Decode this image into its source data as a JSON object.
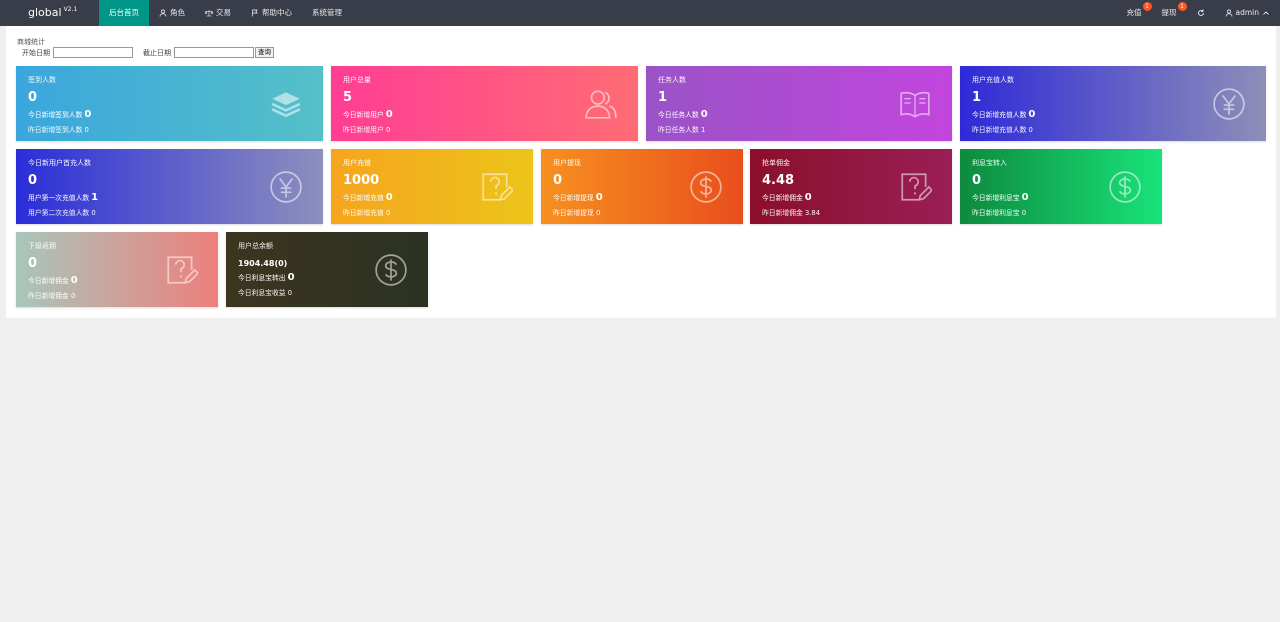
{
  "app": {
    "name": "global",
    "version": "V2.1"
  },
  "nav": [
    {
      "label": "后台首页",
      "icon": "home-icon",
      "active": true
    },
    {
      "label": "角色",
      "icon": "user-icon",
      "active": false
    },
    {
      "label": "交易",
      "icon": "scale-icon",
      "active": false
    },
    {
      "label": "帮助中心",
      "icon": "flag-icon",
      "active": false
    },
    {
      "label": "系统管理",
      "icon": "",
      "active": false
    }
  ],
  "right_nav": {
    "recharge": {
      "label": "充值",
      "badge": "1"
    },
    "withdraw": {
      "label": "提现",
      "badge": "1"
    },
    "refresh_icon": "refresh-icon",
    "user": {
      "label": "admin",
      "icon": "user-icon"
    }
  },
  "section": {
    "title": "商城统计",
    "start_label": "开始日期",
    "end_label": "截止日期",
    "start_value": "",
    "end_value": "",
    "query_label": "查询"
  },
  "cards": [
    {
      "title": "签到人数",
      "value": "0",
      "sub_label": "今日新增签到人数",
      "sub_value": "0",
      "sub2": "昨日新增签到人数 0",
      "icon": "layers-icon",
      "color": "#3aa6dd"
    },
    {
      "title": "用户总量",
      "value": "5",
      "sub_label": "今日新增用户",
      "sub_value": "0",
      "sub2": "昨日新增用户 0",
      "icon": "users-icon",
      "color": "#ff3d94"
    },
    {
      "title": "任务人数",
      "value": "1",
      "sub_label": "今日任务人数",
      "sub_value": "0",
      "sub2": "昨日任务人数 1",
      "icon": "book-icon",
      "color": "#9a53c7"
    },
    {
      "title": "用户充值人数",
      "value": "1",
      "sub_label": "今日新增充值人数",
      "sub_value": "0",
      "sub2": "昨日新增充值人数 0",
      "icon": "yen-icon",
      "color": "#2e2ad8"
    },
    {
      "title": "今日新用户首充人数",
      "value": "0",
      "sub_label": "用户第一次充值人数",
      "sub_value": "1",
      "sub2": "用户第二次充值人数 0",
      "icon": "yen-icon",
      "color": "#2a2ed8"
    },
    {
      "title": "用户充值",
      "value": "1000",
      "sub_label": "今日新增充值",
      "sub_value": "0",
      "sub2": "昨日新增充值 0",
      "icon": "question-edit-icon",
      "color": "#f6a51e"
    },
    {
      "title": "用户提现",
      "value": "0",
      "sub_label": "今日新增提现",
      "sub_value": "0",
      "sub2": "昨日新增提现 0",
      "icon": "dollar-icon",
      "color": "#f7901f"
    },
    {
      "title": "抢单佣金",
      "value": "4.48",
      "sub_label": "今日新增佣金",
      "sub_value": "0",
      "sub2": "昨日新增佣金 3.84",
      "icon": "question-edit-icon",
      "color": "#8b0f2b"
    },
    {
      "title": "利息宝转入",
      "value": "0",
      "sub_label": "今日新增利息宝",
      "sub_value": "0",
      "sub2": "昨日新增利息宝 0",
      "icon": "dollar-icon",
      "color": "#0d8a3e"
    },
    {
      "title": "下级返佣",
      "value": "0",
      "sub_label": "今日新增佣金",
      "sub_value": "0",
      "sub2": "昨日新增佣金 0",
      "icon": "question-edit-icon",
      "color": "#a8c6ba"
    },
    {
      "title": "用户总余额",
      "value": "1904.48(0)",
      "sub_label": "今日利息宝转出",
      "sub_value": "0",
      "sub2": "今日利息宝收益 0",
      "icon": "dollar-icon",
      "color": "#3c3520"
    }
  ]
}
